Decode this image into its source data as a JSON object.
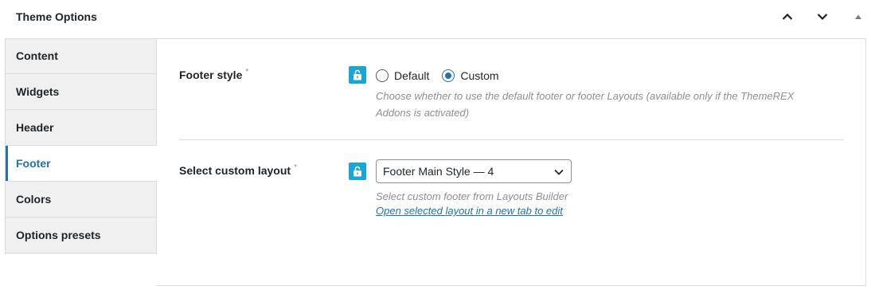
{
  "header": {
    "title": "Theme Options"
  },
  "sidebar": {
    "items": [
      {
        "label": "Content",
        "active": false
      },
      {
        "label": "Widgets",
        "active": false
      },
      {
        "label": "Header",
        "active": false
      },
      {
        "label": "Footer",
        "active": true
      },
      {
        "label": "Colors",
        "active": false
      },
      {
        "label": "Options presets",
        "active": false
      }
    ]
  },
  "footer_style": {
    "label": "Footer style",
    "options": [
      "Default",
      "Custom"
    ],
    "selected": "Custom",
    "description": "Choose whether to use the default footer or footer Layouts (available only if the ThemeREX Addons is activated)"
  },
  "custom_layout": {
    "label": "Select custom layout",
    "value": "Footer Main Style — 4",
    "description": "Select custom footer from Layouts Builder",
    "link": "Open selected layout in a new tab to edit"
  },
  "colors": {
    "accent": "#2271b1",
    "lock": "#19a5d6"
  },
  "icons": {
    "header_up": "chevron-up-icon",
    "header_down": "chevron-down-icon",
    "header_toggle": "triangle-up-icon",
    "lock": "unlock-icon",
    "required": "asterisk-icon"
  }
}
